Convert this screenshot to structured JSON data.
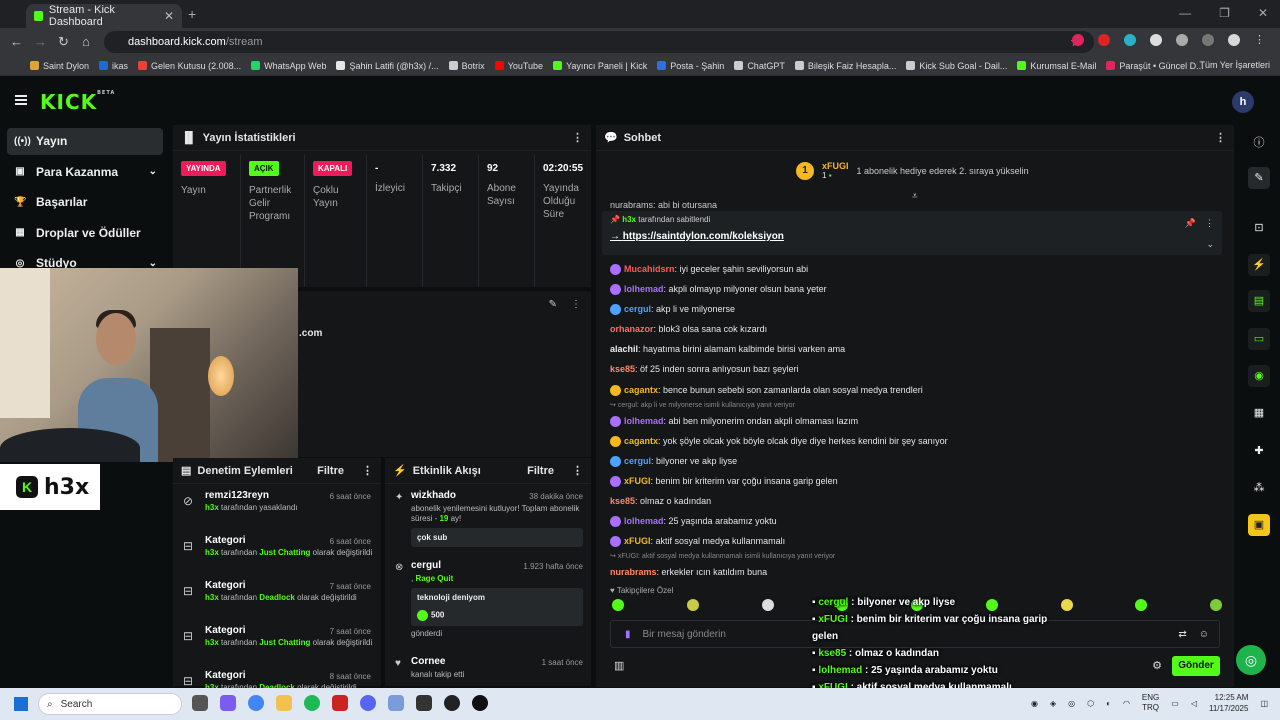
{
  "browser": {
    "tab_title": "Stream - Kick Dashboard",
    "url_host": "dashboard.kick.com",
    "url_path": "/stream",
    "bookmarks": [
      "Saint Dylon",
      "ikas",
      "Gelen Kutusu (2.008...",
      "WhatsApp Web",
      "Şahin Latifi (@h3x) /...",
      "Botrix",
      "YouTube",
      "Yayıncı Paneli | Kick",
      "Posta - Şahin",
      "ChatGPT",
      "Bileşik Faiz Hesapla...",
      "Kick Sub Goal - Dail...",
      "Kurumsal E-Mail",
      "Paraşüt • Güncel D..."
    ],
    "all_bookmarks": "Tüm Yer İşaretleri"
  },
  "kick": {
    "logo": "KICK",
    "logo_sup": "BETA",
    "avatar": "h"
  },
  "sidebar": {
    "items": [
      {
        "label": "Yayın",
        "icon": "broadcast-icon"
      },
      {
        "label": "Para Kazanma",
        "icon": "wallet-icon"
      },
      {
        "label": "Başarılar",
        "icon": "trophy-icon"
      },
      {
        "label": "Droplar ve Ödüller",
        "icon": "gift-icon"
      },
      {
        "label": "Stüdyo",
        "icon": "studio-icon"
      }
    ]
  },
  "stats": {
    "title": "Yayın İstatistikleri",
    "cols": [
      {
        "badge": "YAYINDA",
        "label": "Yayın"
      },
      {
        "badge": "AÇIK",
        "label": "Partnerlik Gelir Programı"
      },
      {
        "badge": "KAPALI",
        "label": "Çoklu Yayın"
      },
      {
        "value": "-",
        "label": "İzleyici"
      },
      {
        "value": "7.332",
        "label": "Takipçi"
      },
      {
        "value": "92",
        "label": "Abone Sayısı"
      },
      {
        "value": "02:20:55",
        "label": "Yayında Olduğu Süre"
      }
    ]
  },
  "mid": {
    "domain_text": ".com"
  },
  "webcam": {
    "logo_text": "h3x"
  },
  "moderation": {
    "title": "Denetim Eylemleri",
    "filter": "Filtre",
    "rows": [
      {
        "title": "remzi123reyn",
        "time": "6 saat önce",
        "by": "h3x",
        "desc": "tarafından yasaklandı",
        "cat": "",
        "tail": ""
      },
      {
        "title": "Kategori",
        "time": "6 saat önce",
        "by": "h3x",
        "desc": "tarafından",
        "cat": "Just Chatting",
        "tail": "olarak değiştirildi"
      },
      {
        "title": "Kategori",
        "time": "7 saat önce",
        "by": "h3x",
        "desc": "tarafından",
        "cat": "Deadlock",
        "tail": "olarak değiştirildi"
      },
      {
        "title": "Kategori",
        "time": "7 saat önce",
        "by": "h3x",
        "desc": "tarafından",
        "cat": "Just Chatting",
        "tail": "olarak değiştirildi"
      },
      {
        "title": "Kategori",
        "time": "8 saat önce",
        "by": "h3x",
        "desc": "tarafından",
        "cat": "Deadlock",
        "tail": "olarak değiştirildi"
      }
    ]
  },
  "activity": {
    "title": "Etkinlik Akışı",
    "filter": "Filtre",
    "items": [
      {
        "user": "wizkhado",
        "time": "38 dakika önce",
        "desc": "abonelik yenilemesini kutluyor! Toplam abonelik süresi -",
        "months": "19",
        "desc_tail": "ay!",
        "bubble": "çok sub"
      },
      {
        "user": "cergul",
        "time": "1.923 hafta önce",
        "game": "Rage Quit",
        "bubble": "teknoloji deniyom",
        "amount": "500",
        "sent": "gönderdi"
      },
      {
        "user": "Cornee",
        "time": "1 saat önce",
        "desc": "kanalı takip etti"
      }
    ]
  },
  "chat": {
    "title": "Sohbet",
    "sub_user": "xFUGI",
    "sub_count": "1",
    "sub_text": "1 abonelik hediye ederek 2. sıraya yükselin",
    "top_cut": "nurabrams: abi bi otursana",
    "pinned_by": "h3x",
    "pinned_label": "tarafından sabitlendi",
    "pinned_link": "https://saintdylon.com/koleksiyon",
    "messages": [
      {
        "user": "Mucahidsrn",
        "color": "#ff5a5a",
        "text": "iyi geceler şahin seviliyorsun abi",
        "badge": "#a970ff"
      },
      {
        "user": "lolhemad",
        "color": "#a970ff",
        "text": "akpli olmayıp milyoner olsun bana yeter",
        "badge": "#a970ff"
      },
      {
        "user": "cergul",
        "color": "#4ea3ff",
        "text": "akp li ve milyonerse",
        "badge": "#4ea3ff"
      },
      {
        "user": "orhanazor",
        "color": "#ff6b6b",
        "text": "blok3 olsa sana cok kızardı",
        "badge": ""
      },
      {
        "user": "alachil",
        "color": "#eeeeee",
        "text": "hayatıma birini alamam kalbimde birisi varken ama",
        "badge": ""
      },
      {
        "user": "kse85",
        "color": "#ff8a65",
        "text": "öf 25 inden sonra anlıyosun bazı şeyleri",
        "badge": ""
      },
      {
        "user": "cagantx",
        "color": "#f5b81f",
        "text": "bence bunun sebebi son zamanlarda olan sosyal medya trendleri",
        "badge": "#f5b81f"
      },
      {
        "reply": "cergul: akp li ve milyonerse isimli kullanıcıya yanıt veriyor"
      },
      {
        "user": "lolhemad",
        "color": "#a970ff",
        "text": "abi ben milyonerim ondan akpli olmaması lazım",
        "badge": "#a970ff"
      },
      {
        "user": "cagantx",
        "color": "#f5b81f",
        "text": "yok şöyle olcak yok böyle olcak diye diye herkes kendini bir şey sanıyor",
        "badge": "#f5b81f"
      },
      {
        "user": "cergul",
        "color": "#4ea3ff",
        "text": "bilyoner ve akp liyse",
        "badge": "#4ea3ff"
      },
      {
        "user": "xFUGI",
        "color": "#f5b81f",
        "text": "benim bir kriterim var çoğu insana garip gelen",
        "badge": "#a970ff"
      },
      {
        "user": "kse85",
        "color": "#ff8a65",
        "text": "olmaz o kadından",
        "badge": ""
      },
      {
        "user": "lolhemad",
        "color": "#a970ff",
        "text": "25 yaşında arabamız yoktu",
        "badge": "#a970ff"
      },
      {
        "user": "xFUGI",
        "color": "#f5b81f",
        "text": "aktif sosyal medya kullanmamalı",
        "badge": "#a970ff"
      },
      {
        "reply": "xFUGI: aktif sosyal medya kullanmamalı isimli kullanıcıya yanıt veriyor"
      },
      {
        "user": "nurabrams",
        "color": "#ff8a65",
        "text": "erkekler ıcın katıldım buna",
        "badge": ""
      }
    ],
    "followers_only": "Takipçilere Özel",
    "input_placeholder": "Bir mesaj gönderin",
    "send": "Gönder"
  },
  "overlay": {
    "lines": [
      {
        "user": "cergul",
        "text": ": bilyoner ve akp liyse"
      },
      {
        "user": "xFUGI",
        "text": ": benim bir kriterim var çoğu insana garip gelen"
      },
      {
        "user": "kse85",
        "text": ": olmaz o kadından"
      },
      {
        "user": "lolhemad",
        "text": ": 25 yaşında arabamız yoktu"
      },
      {
        "user": "xFUGI",
        "text": ": aktif sosyal medya kullanmamalı"
      },
      {
        "user": "nurabrams",
        "text": ": erkekler ıcın katıldım buna"
      }
    ]
  },
  "taskbar": {
    "search": "Search",
    "lang1": "ENG",
    "lang2": "TRQ",
    "time": "12:25 AM",
    "date": "11/17/2025"
  }
}
